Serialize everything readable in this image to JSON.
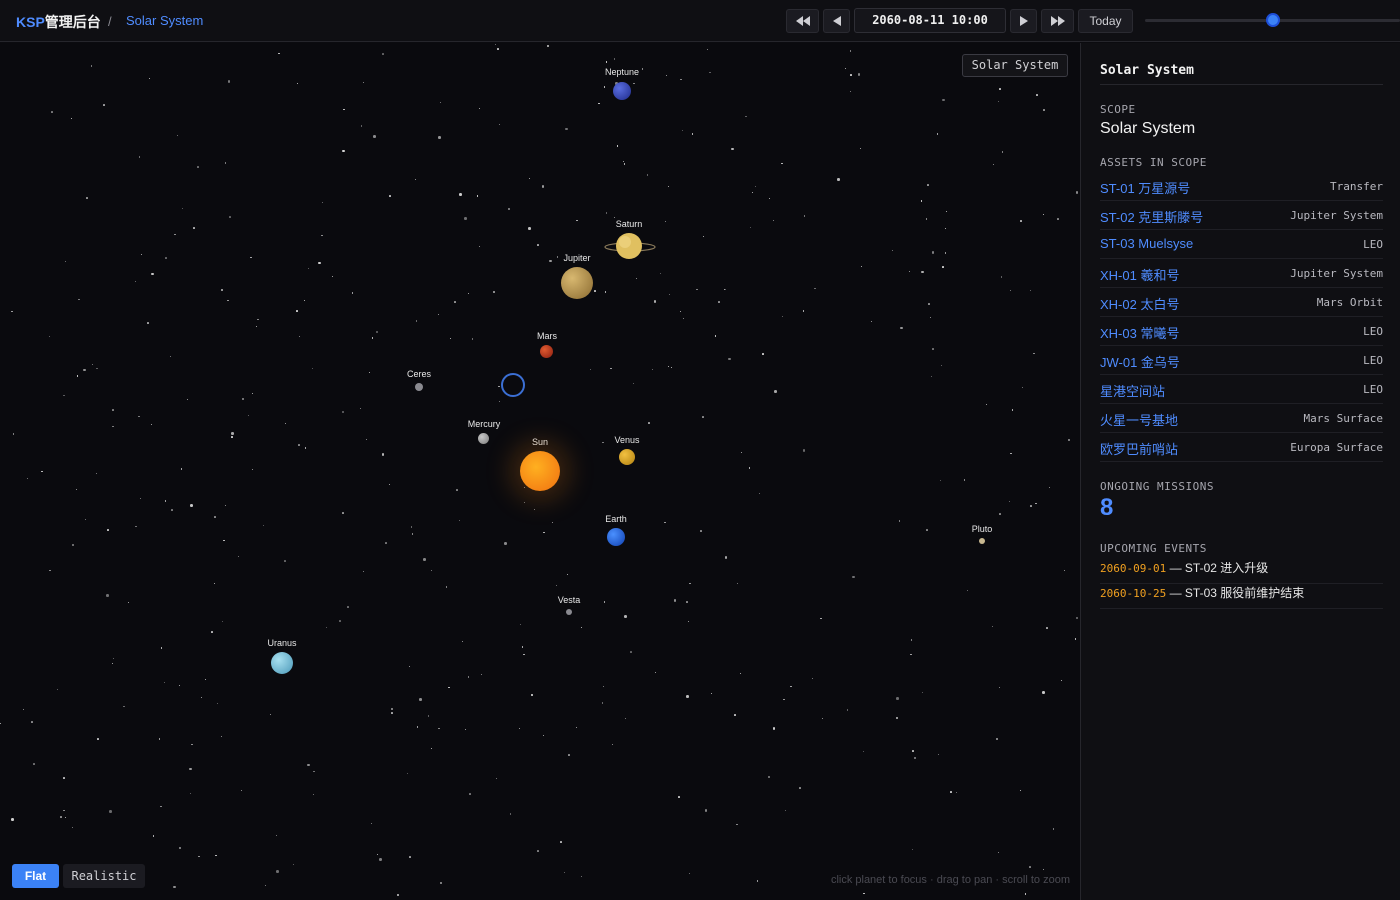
{
  "header": {
    "brand_prefix": "KSP",
    "brand_suffix": "管理后台",
    "breadcrumb_sep": "/",
    "breadcrumb": "Solar System",
    "date": "2060-08-11 10:00",
    "today_label": "Today",
    "timeline_progress": 0.5
  },
  "space": {
    "scope_chip": "Solar System",
    "planets": {
      "neptune": "Neptune",
      "saturn": "Saturn",
      "jupiter": "Jupiter",
      "mars": "Mars",
      "ceres": "Ceres",
      "mercury": "Mercury",
      "sun": "Sun",
      "venus": "Venus",
      "earth": "Earth",
      "pluto": "Pluto",
      "vesta": "Vesta",
      "uranus": "Uranus"
    },
    "mode_flat": "Flat",
    "mode_realistic": "Realistic",
    "hint": "click planet to focus · drag to pan · scroll to zoom"
  },
  "sidebar": {
    "title": "Solar System",
    "scope_label": "SCOPE",
    "scope_value": "Solar System",
    "assets_label": "ASSETS IN SCOPE",
    "assets": [
      {
        "name": "ST-01 万星源号",
        "location": "Transfer"
      },
      {
        "name": "ST-02 克里斯滕号",
        "location": "Jupiter System"
      },
      {
        "name": "ST-03 Muelsyse",
        "location": "LEO"
      },
      {
        "name": "XH-01 羲和号",
        "location": "Jupiter System"
      },
      {
        "name": "XH-02 太白号",
        "location": "Mars Orbit"
      },
      {
        "name": "XH-03 常曦号",
        "location": "LEO"
      },
      {
        "name": "JW-01 金乌号",
        "location": "LEO"
      },
      {
        "name": "星港空间站",
        "location": "LEO"
      },
      {
        "name": "火星一号基地",
        "location": "Mars Surface"
      },
      {
        "name": "欧罗巴前哨站",
        "location": "Europa Surface"
      }
    ],
    "missions_label": "ONGOING MISSIONS",
    "missions_count": "8",
    "events_label": "UPCOMING EVENTS",
    "events": [
      {
        "date": "2060-09-01",
        "sep": " — ",
        "text": "ST-02 进入升级"
      },
      {
        "date": "2060-10-25",
        "sep": " — ",
        "text": "ST-03 服役前维护结束"
      }
    ]
  }
}
